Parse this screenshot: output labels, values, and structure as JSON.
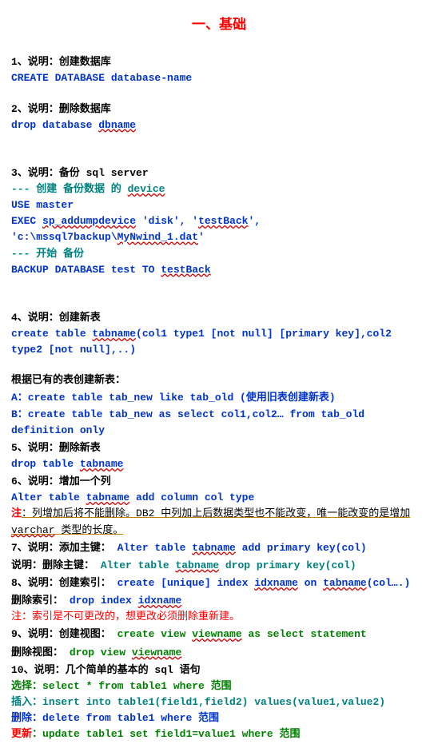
{
  "title": "一、基础",
  "s1": {
    "h": "1、说明：创建数据库",
    "c": "CREATE DATABASE database-name"
  },
  "s2": {
    "h": "2、说明：删除数据库",
    "c1": "drop database ",
    "db": "dbname"
  },
  "s3": {
    "h": "3、说明：备份 sql server",
    "c1a": "--- 创建 备份数据 的 ",
    "c1b": "device",
    "c2": "USE master",
    "c3a": "EXEC ",
    "c3b": "sp_addumpdevice",
    "c3c": " 'disk', '",
    "c3d": "testBack",
    "c3e": "', 'c:\\mssql7backup\\",
    "c3f": "MyNwind_1.dat",
    "c3g": "'",
    "c4": "--- 开始 备份",
    "c5a": "BACKUP DATABASE test TO ",
    "c5b": "testBack"
  },
  "s4": {
    "h": "4、说明：创建新表",
    "c1a": "create table ",
    "c1b": "tabname",
    "c1c": "(col1 type1 [not null] [primary key],col2 type2 [not null],..)",
    "p": "根据已有的表创建新表：",
    "a": "A：create table tab_new like tab_old (使用旧表创建新表)",
    "b": "B：create table tab_new as select col1,col2… from tab_old definition only"
  },
  "s5": {
    "h": "5、说明：删除新表",
    "c1a": "drop table ",
    "c1b": "tabname"
  },
  "s6": {
    "h": "6、说明：增加一个列",
    "c1a": "Alter table ",
    "c1b": "tabname",
    "c1c": " add column col type",
    "na": "注",
    "nb": "：列增加后将不能删除。DB2 中列加上后数据类型也不能改变，唯一能改变的是增加 ",
    "nc": "varchar",
    "nd": " 类型的长度。"
  },
  "s7": {
    "h": "7、说明：添加主键：  ",
    "c1a": "Alter table ",
    "c1b": "tabname",
    "c1c": " add primary key(col)",
    "h2": "说明：删除主键：  ",
    "c2a": "Alter table ",
    "c2b": "tabname",
    "c2c": " drop primary key(col)"
  },
  "s8": {
    "h": "8、说明：创建索引：",
    "c1a": "create [unique] index ",
    "c1b": "idxname",
    "c1c": " on ",
    "c1d": "tabname",
    "c1e": "(col….)",
    "h2": "删除索引：",
    "c2a": "drop index ",
    "c2b": "idxname",
    "n": "注：索引是不可更改的，想更改必须删除重新建。"
  },
  "s9": {
    "h": "9、说明：创建视图：",
    "c1a": "create view ",
    "c1b": "viewname",
    "c1c": " as select statement",
    "h2": "删除视图：",
    "c2a": "drop view ",
    "c2b": "viewname"
  },
  "s10": {
    "h": "10、说明：几个简单的基本的 sql 语句",
    "sel_l": "选择",
    "sel_c": "：select * from table1 where 范围",
    "ins_l": "插入",
    "ins_c": "：insert into table1(field1,field2) values(value1,value2)",
    "del_l": "删除",
    "del_c": "：delete from table1 where 范围",
    "upd_l": "更新",
    "upd_c": "：update table1 set field1=value1 where 范围"
  }
}
